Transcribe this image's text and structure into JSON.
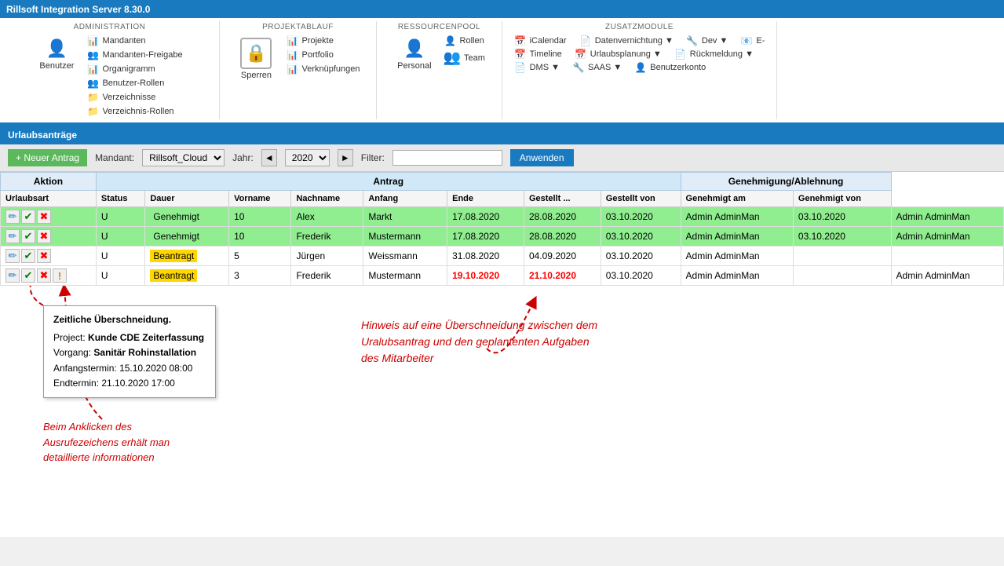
{
  "app": {
    "title": "Rillsoft Integration Server 8.30.0"
  },
  "ribbon": {
    "sections": [
      {
        "id": "administration",
        "title": "ADMINISTRATION",
        "bigItems": [
          {
            "label": "Benutzer",
            "icon": "👤"
          }
        ],
        "smallItems": [
          {
            "label": "Mandanten",
            "icon": "📊"
          },
          {
            "label": "Mandanten-Freigabe",
            "icon": "📊"
          },
          {
            "label": "Organigramm",
            "icon": "📊"
          },
          {
            "label": "Benutzer-Rollen",
            "icon": "👥"
          },
          {
            "label": "Verzeichnisse",
            "icon": "📁"
          },
          {
            "label": "Verzeichnis-Rollen",
            "icon": "📁"
          }
        ]
      },
      {
        "id": "projektablauf",
        "title": "PROJEKTABLAUF",
        "bigItems": [
          {
            "label": "Sperren",
            "icon": "🔒"
          }
        ],
        "smallItems": [
          {
            "label": "Projekte",
            "icon": "📊"
          },
          {
            "label": "Portfolio",
            "icon": "📊"
          },
          {
            "label": "Verknüpfungen",
            "icon": "📊"
          }
        ]
      },
      {
        "id": "ressourcenpool",
        "title": "RESSOURCENPOOL",
        "bigItems": [
          {
            "label": "Personal",
            "icon": "👤"
          },
          {
            "label": "Team",
            "icon": "👥"
          }
        ],
        "smallItems": [
          {
            "label": "Rollen",
            "icon": "👤"
          }
        ]
      },
      {
        "id": "zusatzmodule",
        "title": "ZUSATZMODULE",
        "smallItems": [
          {
            "label": "iCalendar",
            "icon": "📅"
          },
          {
            "label": "Datenvernichtung ▼",
            "icon": "📄"
          },
          {
            "label": "Dev ▼",
            "icon": "🔧"
          },
          {
            "label": "E-",
            "icon": ""
          },
          {
            "label": "Timeline",
            "icon": "📅"
          },
          {
            "label": "Urlaubsplanung ▼",
            "icon": "📅"
          },
          {
            "label": "Rückmeldung ▼",
            "icon": "📄"
          },
          {
            "label": "DMS ▼",
            "icon": "📄"
          },
          {
            "label": "SAAS ▼",
            "icon": "🔧"
          },
          {
            "label": "Benutzerkonto",
            "icon": "👤"
          }
        ]
      }
    ]
  },
  "section_header": "Urlaubsanträge",
  "toolbar": {
    "new_button": "+ Neuer Antrag",
    "mandant_label": "Mandant:",
    "mandant_value": "Rillsoft_Cloud",
    "year_label": "Jahr:",
    "year_value": "2020",
    "filter_label": "Filter:",
    "filter_value": "",
    "apply_button": "Anwenden"
  },
  "table": {
    "group_headers": [
      {
        "label": "Aktion",
        "colspan": 1
      },
      {
        "label": "Antrag",
        "colspan": 8
      },
      {
        "label": "Genehmigung/Ablehnung",
        "colspan": 2
      }
    ],
    "col_headers": [
      "Urlaubsart",
      "Status",
      "Dauer",
      "Vorname",
      "Nachname",
      "Anfang",
      "Ende",
      "Gestellt ...",
      "Gestellt von",
      "Genehmigt am",
      "Genehmigt von"
    ],
    "rows": [
      {
        "row_class": "row-green",
        "urlaubsart": "U",
        "status": "Genehmigt",
        "status_class": "status-green",
        "dauer": "10",
        "vorname": "Alex",
        "nachname": "Markt",
        "anfang": "17.08.2020",
        "ende": "28.08.2020",
        "gestellt": "03.10.2020",
        "gestellt_von": "Admin AdminMan",
        "genehmigt_am": "03.10.2020",
        "genehmigt_von": "Admin AdminMan",
        "anfang_red": false
      },
      {
        "row_class": "row-green",
        "urlaubsart": "U",
        "status": "Genehmigt",
        "status_class": "status-green",
        "dauer": "10",
        "vorname": "Frederik",
        "nachname": "Mustermann",
        "anfang": "17.08.2020",
        "ende": "28.08.2020",
        "gestellt": "03.10.2020",
        "gestellt_von": "Admin AdminMan",
        "genehmigt_am": "03.10.2020",
        "genehmigt_von": "Admin AdminMan",
        "anfang_red": false
      },
      {
        "row_class": "row-white",
        "urlaubsart": "U",
        "status": "Beantragt",
        "status_class": "status-orange",
        "dauer": "5",
        "vorname": "Jürgen",
        "nachname": "Weissmann",
        "anfang": "31.08.2020",
        "ende": "04.09.2020",
        "gestellt": "03.10.2020",
        "gestellt_von": "Admin AdminMan",
        "genehmigt_am": "",
        "genehmigt_von": "",
        "anfang_red": false
      },
      {
        "row_class": "row-white",
        "urlaubsart": "U",
        "status": "Beantragt",
        "status_class": "status-orange",
        "dauer": "3",
        "vorname": "Frederik",
        "nachname": "Mustermann",
        "anfang": "19.10.2020",
        "ende": "21.10.2020",
        "gestellt": "03.10.2020",
        "gestellt_von": "Admin AdminMan",
        "genehmigt_am": "",
        "genehmigt_von": "Admin AdminMan",
        "anfang_red": true
      }
    ]
  },
  "tooltip": {
    "title": "Zeitliche Überschneidung.",
    "project_label": "Project:",
    "project_value": "Kunde CDE Zeiterfassung",
    "vorgang_label": "Vorgang:",
    "vorgang_value": "Sanitär Rohinstallation",
    "anfang_label": "Anfangstermin:",
    "anfang_value": "15.10.2020 08:00",
    "end_label": "Endtermin:",
    "end_value": "21.10.2020 17:00"
  },
  "annotation1": {
    "text": "Beim Anklicken des\nAusrufezeichens erhält man\ndetaillierte informationen"
  },
  "annotation2": {
    "text": "Hinweis auf eine Überschneidung zwischen dem\nUralubsantrag und den geplantenten Aufgaben\ndes Mitarbeiter"
  }
}
